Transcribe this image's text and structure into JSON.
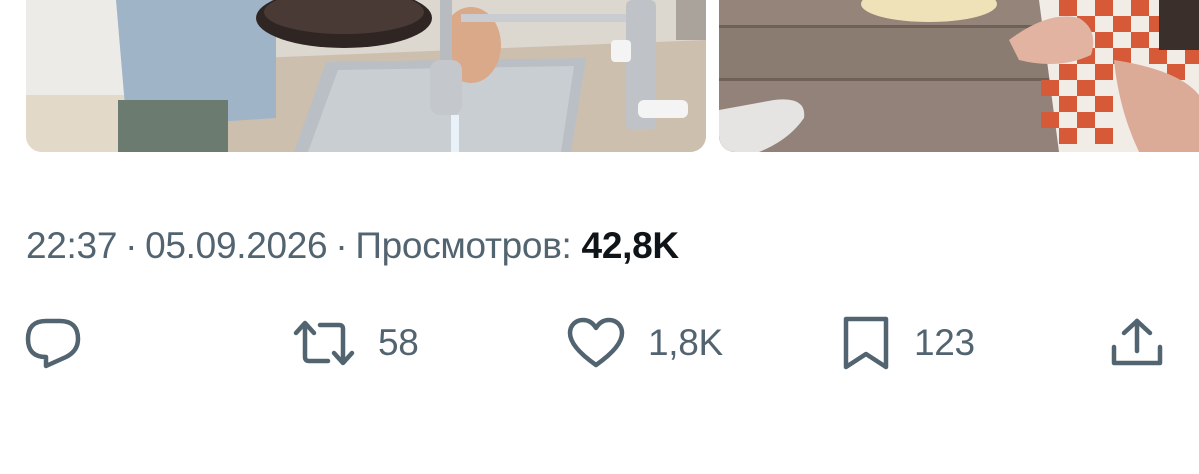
{
  "tweet": {
    "meta": {
      "time": "22:37",
      "separator": "·",
      "date": "05.09.2026",
      "views_label": "Просмотров:",
      "views_count": "42,8K"
    },
    "actions": {
      "reply": {
        "icon": "reply-icon",
        "count": ""
      },
      "repost": {
        "icon": "repost-icon",
        "count": "58"
      },
      "like": {
        "icon": "heart-icon",
        "count": "1,8K"
      },
      "bookmark": {
        "icon": "bookmark-icon",
        "count": "123"
      },
      "share": {
        "icon": "share-icon",
        "count": ""
      }
    },
    "media": [
      {
        "name": "photo-kitchen-sink"
      },
      {
        "name": "photo-deck-towel"
      }
    ]
  },
  "colors": {
    "secondary_text": "#536471",
    "primary_text": "#0f1419",
    "background": "#ffffff"
  }
}
